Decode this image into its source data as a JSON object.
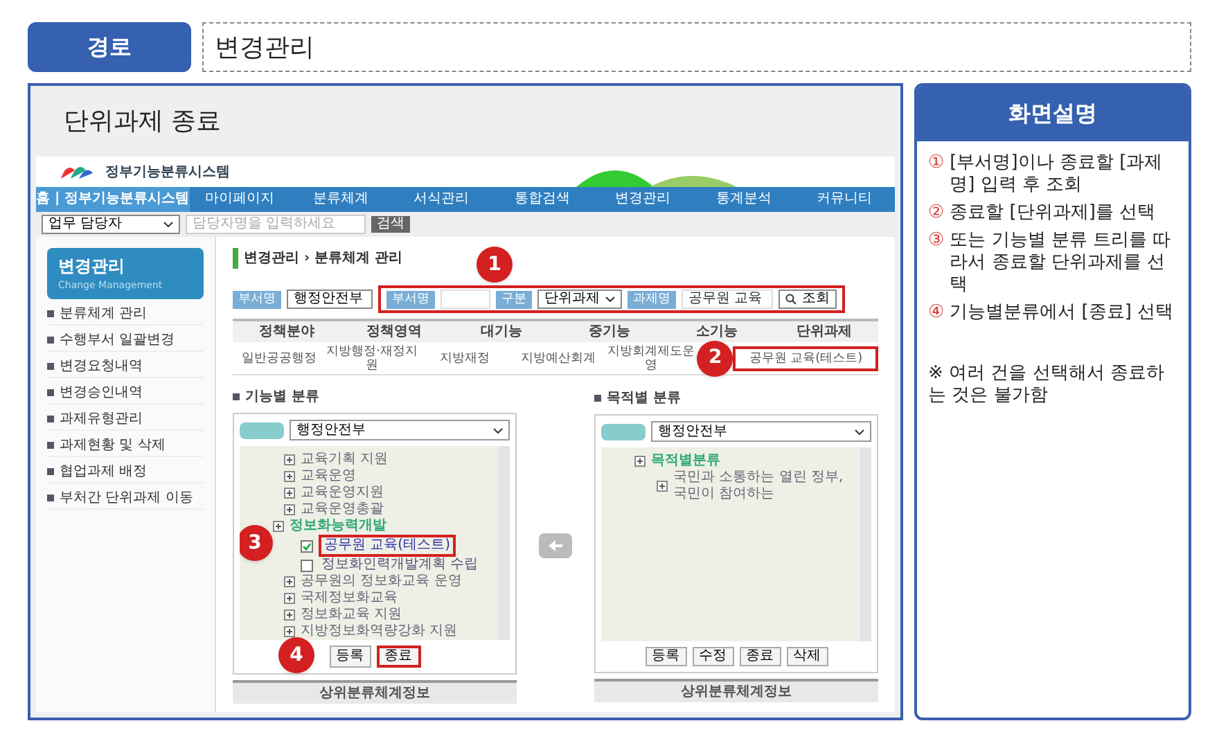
{
  "path": {
    "label": "경로",
    "value": "변경관리"
  },
  "page_title": "단위과제 종료",
  "app": {
    "system_name": "정부기능분류시스템",
    "nav": [
      {
        "label": "홈 | 정부기능분류시스템",
        "selected": true
      },
      {
        "label": "마이페이지",
        "selected": false
      },
      {
        "label": "분류체계",
        "selected": false
      },
      {
        "label": "서식관리",
        "selected": false
      },
      {
        "label": "통합검색",
        "selected": false
      },
      {
        "label": "변경관리",
        "selected": false
      },
      {
        "label": "통계분석",
        "selected": false
      },
      {
        "label": "커뮤니티",
        "selected": false
      }
    ],
    "user_search": {
      "select": "업무 담당자",
      "placeholder": "담당자명을 입력하세요",
      "button": "검색"
    },
    "sidebar": {
      "title": "변경관리",
      "subtitle": "Change Management",
      "items": [
        "분류체계 관리",
        "수행부서 일괄변경",
        "변경요청내역",
        "변경승인내역",
        "과제유형관리",
        "과제현황 및 삭제",
        "협업과제 배정",
        "부처간 단위과제 이동"
      ]
    },
    "breadcrumb": "변경관리 › 분류체계 관리",
    "filter": {
      "dept_label": "부서명",
      "dept_value": "행정안전부",
      "callout": "1",
      "highlight": true,
      "fields": [
        {
          "kind": "input",
          "label": "부서명"
        },
        {
          "kind": "select",
          "label": "구분",
          "value": "단위과제"
        },
        {
          "kind": "input",
          "label": "과제명",
          "value": "공무원 교육"
        }
      ],
      "button": "조회"
    },
    "table": {
      "columns": [
        "정책분야",
        "정책영역",
        "대기능",
        "중기능",
        "소기능",
        "단위과제"
      ],
      "rows": [
        {
          "cells": [
            "일반공공행정",
            "지방행정·재정지원",
            "지방재정",
            "지방예산회계",
            "지방회계제도운영",
            "공무원 교육(테스트)"
          ],
          "highlight_last": true,
          "callout": "2"
        }
      ]
    },
    "trees": [
      {
        "title": "기능별 분류",
        "select": "행정안전부",
        "callout": "3",
        "items": [
          {
            "kind": "node",
            "label": "교육기획 지원"
          },
          {
            "kind": "node",
            "label": "교육운영"
          },
          {
            "kind": "node",
            "label": "교육운영지원"
          },
          {
            "kind": "node",
            "label": "교육운영총괄"
          },
          {
            "kind": "group",
            "label": "정보화능력개발",
            "children": [
              {
                "kind": "check",
                "label": "공무원 교육(테스트)",
                "checked": true,
                "highlight": true
              },
              {
                "kind": "check",
                "label": "정보화인력개발계획 수립",
                "checked": false,
                "highlight": false
              }
            ]
          },
          {
            "kind": "node",
            "label": "공무원의 정보화교육 운영"
          },
          {
            "kind": "node",
            "label": "국제정보화교육"
          },
          {
            "kind": "node",
            "label": "정보화교육 지원"
          },
          {
            "kind": "node",
            "label": "지방정보화역량강화 지원"
          }
        ],
        "buttons": [
          {
            "label": "등록",
            "highlight": false
          },
          {
            "label": "종료",
            "highlight": true
          }
        ],
        "buttons_callout": "4",
        "footer": "상위분류체계정보"
      },
      {
        "title": "목적별 분류",
        "select": "행정안전부",
        "items": [
          {
            "kind": "group",
            "label": "목적별분류",
            "children": [
              {
                "kind": "node",
                "label": "국민과 소통하는 열린 정부, 국민이 참여하는"
              }
            ]
          }
        ],
        "buttons": [
          {
            "label": "등록",
            "highlight": false
          },
          {
            "label": "수정",
            "highlight": false
          },
          {
            "label": "종료",
            "highlight": false
          },
          {
            "label": "삭제",
            "highlight": false
          }
        ],
        "footer": "상위분류체계정보"
      }
    ]
  },
  "description": {
    "title": "화면설명",
    "steps": [
      {
        "marker": "①",
        "text": "[부서명]이나 종료할 [과제명] 입력 후 조회"
      },
      {
        "marker": "②",
        "text": "종료할 [단위과제]를 선택"
      },
      {
        "marker": "③",
        "text": "또는 기능별 분류 트리를 따라서 종료할 단위과제를 선택"
      },
      {
        "marker": "④",
        "text": "기능별분류에서 [종료] 선택"
      }
    ],
    "note": "※ 여러 건을 선택해서 종료하는 것은 불가함"
  }
}
